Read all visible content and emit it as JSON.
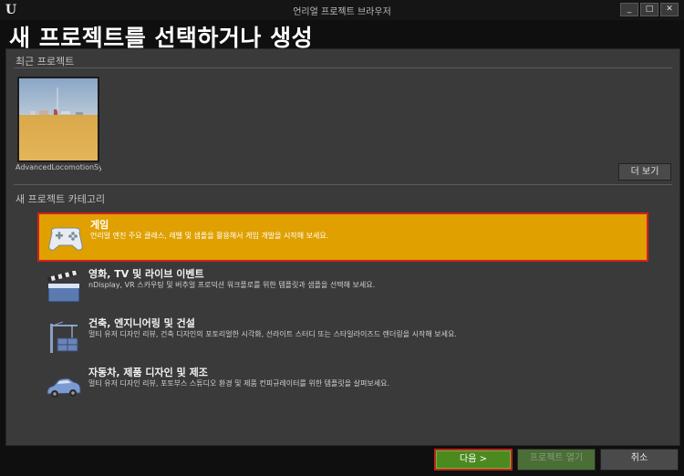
{
  "window": {
    "logo": "U",
    "title": "언리얼 프로젝트 브라우저",
    "controls": [
      "_",
      "□",
      "✕"
    ]
  },
  "heading": "새 프로젝트를 선택하거나 생성",
  "recent": {
    "label": "최근 프로젝트",
    "projects": [
      {
        "name": "AdvancedLocomotionSys"
      }
    ],
    "more_label": "더 보기"
  },
  "categories_label": "새 프로젝트 카테고리",
  "categories": [
    {
      "name": "게임",
      "desc": "언리얼 엔진 주요 클래스, 레벨 및 샘플을 활용해서 게임 개발을 시작해 보세요.",
      "icon": "gamepad-icon",
      "selected": true
    },
    {
      "name": "영화, TV 및 라이브 이벤트",
      "desc": "nDisplay, VR 스카우팅 및 버추얼 프로덕션 워크플로를 위한 템플릿과 샘플을 선택해 보세요.",
      "icon": "clapperboard-icon",
      "selected": false
    },
    {
      "name": "건축, 엔지니어링 및 건설",
      "desc": "멀티 유저 디자인 리뷰, 건축 디자인의 포토리얼한 시각화, 선라이트 스터디 또는 스타일라이즈드 렌더링을 시작해 보세요.",
      "icon": "crane-icon",
      "selected": false
    },
    {
      "name": "자동차, 제품 디자인 및 제조",
      "desc": "멀티 유저 디자인 리뷰, 포토부스 스튜디오 환경 및 제품 컨피규레이터를 위한 템플릿을 살펴보세요.",
      "icon": "car-icon",
      "selected": false
    }
  ],
  "footer": {
    "next_label": "다음 >",
    "open_label": "프로젝트 열기",
    "cancel_label": "취소"
  },
  "colors": {
    "selected_bg": "#e0a000",
    "highlight_border": "#d32020",
    "next_button": "#4c8a1f"
  }
}
